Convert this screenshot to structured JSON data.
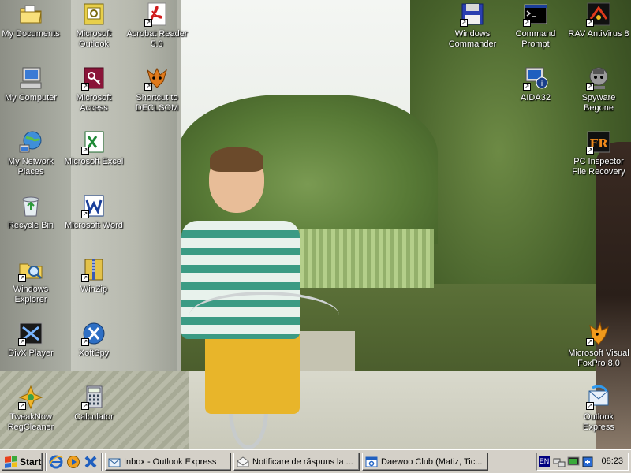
{
  "desktop": {
    "icons": [
      {
        "label": "My Documents",
        "icon": "my-documents-icon",
        "shortcut": false
      },
      {
        "label": "Microsoft Outlook",
        "icon": "outlook-icon",
        "shortcut": false
      },
      {
        "label": "Acrobat Reader 5.0",
        "icon": "acrobat-reader-icon",
        "shortcut": true
      },
      {
        "label": "Windows Commander",
        "icon": "windows-commander-icon",
        "shortcut": true
      },
      {
        "label": "Command Prompt",
        "icon": "command-prompt-icon",
        "shortcut": true
      },
      {
        "label": "RAV AntiVirus 8",
        "icon": "rav-antivirus-icon",
        "shortcut": true
      },
      {
        "label": "My Computer",
        "icon": "my-computer-icon",
        "shortcut": false
      },
      {
        "label": "Microsoft Access",
        "icon": "access-icon",
        "shortcut": true
      },
      {
        "label": "Shortcut to DECLSOM",
        "icon": "declsom-icon",
        "shortcut": true
      },
      {
        "label": "AIDA32",
        "icon": "aida32-icon",
        "shortcut": true
      },
      {
        "label": "Spyware Begone",
        "icon": "spyware-begone-icon",
        "shortcut": true
      },
      {
        "label": "My Network Places",
        "icon": "network-places-icon",
        "shortcut": false
      },
      {
        "label": "Microsoft Excel",
        "icon": "excel-icon",
        "shortcut": true
      },
      {
        "label": "PC Inspector File Recovery",
        "icon": "pc-inspector-icon",
        "shortcut": true
      },
      {
        "label": "Recycle Bin",
        "icon": "recycle-bin-icon",
        "shortcut": false
      },
      {
        "label": "Microsoft Word",
        "icon": "word-icon",
        "shortcut": true
      },
      {
        "label": "Windows Explorer",
        "icon": "windows-explorer-icon",
        "shortcut": true
      },
      {
        "label": "WinZip",
        "icon": "winzip-icon",
        "shortcut": true
      },
      {
        "label": "DivX Player",
        "icon": "divx-player-icon",
        "shortcut": true
      },
      {
        "label": "XoftSpy",
        "icon": "xoftspy-icon",
        "shortcut": true
      },
      {
        "label": "Microsoft Visual FoxPro 8.0",
        "icon": "foxpro-icon",
        "shortcut": true
      },
      {
        "label": "TweakNow RegCleaner",
        "icon": "regcleaner-icon",
        "shortcut": true
      },
      {
        "label": "Calculator",
        "icon": "calculator-icon",
        "shortcut": true
      },
      {
        "label": "Outlook Express",
        "icon": "outlook-express-icon",
        "shortcut": true
      }
    ]
  },
  "taskbar": {
    "start_label": "Start",
    "quick_launch": [
      {
        "name": "ie-quicklaunch-icon"
      },
      {
        "name": "media-player-quicklaunch-icon"
      },
      {
        "name": "xoftspy-quicklaunch-icon"
      }
    ],
    "tasks": [
      {
        "label": "Inbox - Outlook Express",
        "icon": "outlook-express-icon"
      },
      {
        "label": "Notificare de răspuns la ...",
        "icon": "mail-read-icon"
      },
      {
        "label": "Daewoo Club (Matiz, Tic...",
        "icon": "ie-window-icon"
      }
    ],
    "tray": {
      "language": "EN",
      "clock": "08:23"
    }
  },
  "colors": {
    "taskbar": "#d4d0c8",
    "label_text": "#ffffff"
  }
}
